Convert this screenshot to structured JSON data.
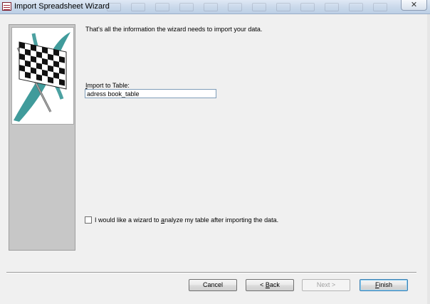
{
  "window": {
    "title": "Import Spreadsheet Wizard",
    "close_glyph": "✕",
    "icon": "access-app-icon"
  },
  "side_panel": {
    "image": "checkered-flag-icon"
  },
  "main": {
    "intro_text": "That's all the information the wizard needs to import your data.",
    "import_label_prefix": "I",
    "import_label_rest": "mport to Table:",
    "import_table_value": "adress book_table",
    "analyze_checkbox": {
      "checked": false,
      "label_prefix": "I would like a wizard to ",
      "label_hotkey": "a",
      "label_rest": "nalyze my table after importing the data."
    }
  },
  "buttons": {
    "cancel": "Cancel",
    "back_prefix": "< ",
    "back_hotkey": "B",
    "back_rest": "ack",
    "next": "Next >",
    "finish_hotkey": "F",
    "finish_rest": "inish"
  },
  "colors": {
    "panel_gray": "#c7c7c7",
    "flag_teal": "#1f8a8a",
    "input_border": "#7f9db9"
  }
}
